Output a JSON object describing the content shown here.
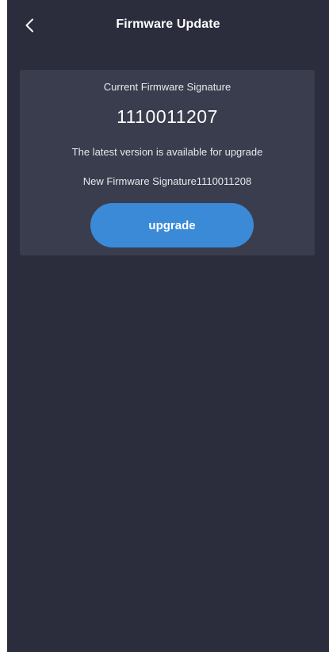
{
  "header": {
    "title": "Firmware Update",
    "back_icon": "chevron-left-icon"
  },
  "firmware": {
    "current_label": "Current Firmware Signature",
    "current_value": "1110011207",
    "latest_note": "The latest version is available for upgrade",
    "new_signature_text": "New Firmware Signature1110011208",
    "upgrade_label": "upgrade"
  },
  "colors": {
    "background": "#2b2d3c",
    "card": "#3a3d4d",
    "accent": "#3b8ad8",
    "text": "#ffffff"
  }
}
